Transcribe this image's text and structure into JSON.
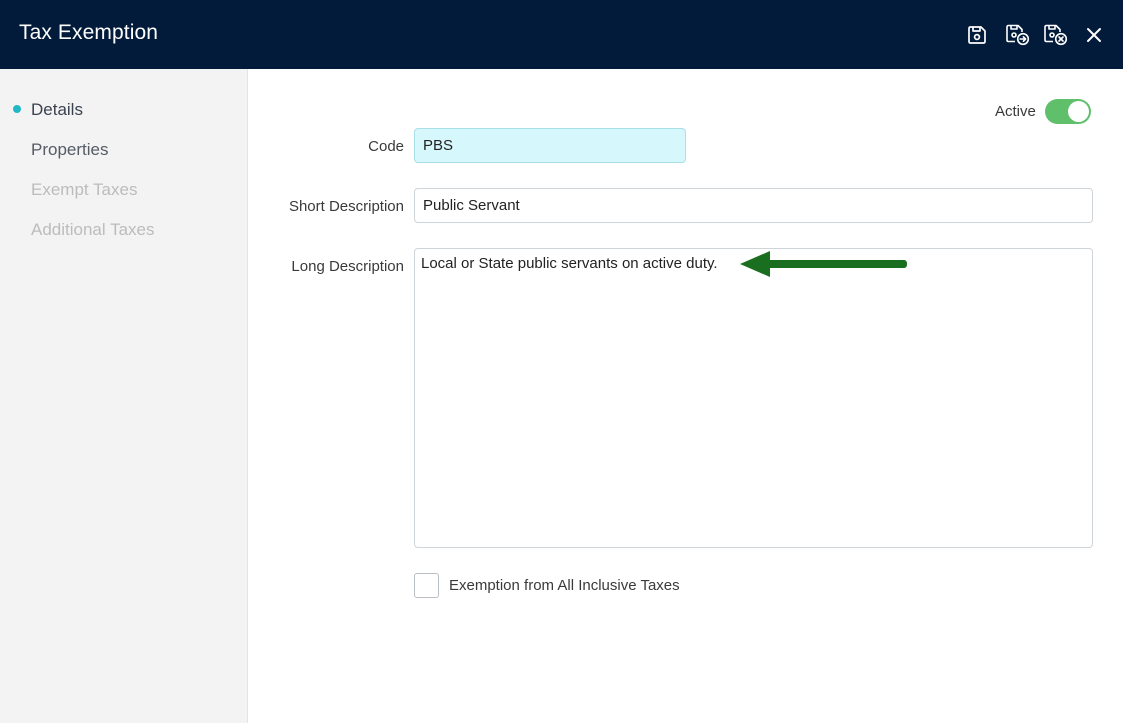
{
  "window": {
    "title": "Tax Exemption",
    "toolbar_icons": [
      "save-icon",
      "save-and-new-icon",
      "save-and-close-icon",
      "close-icon"
    ]
  },
  "sidebar": {
    "items": [
      {
        "label": "Details",
        "state": "active"
      },
      {
        "label": "Properties",
        "state": "normal"
      },
      {
        "label": "Exempt Taxes",
        "state": "disabled"
      },
      {
        "label": "Additional Taxes",
        "state": "disabled"
      }
    ]
  },
  "form": {
    "active_label": "Active",
    "active_on": true,
    "code_label": "Code",
    "code_value": "PBS",
    "short_description_label": "Short Description",
    "short_description_value": "Public Servant",
    "long_description_label": "Long Description",
    "long_description_value": "Local or State public servants on active duty.",
    "inclusive_exemption_label": "Exemption from All Inclusive Taxes",
    "inclusive_exemption_checked": false
  },
  "colors": {
    "titlebar": "#021b3a",
    "accent": "#21b8c6",
    "toggle_on": "#5fbf6a",
    "arrow": "#1a6e1f"
  }
}
